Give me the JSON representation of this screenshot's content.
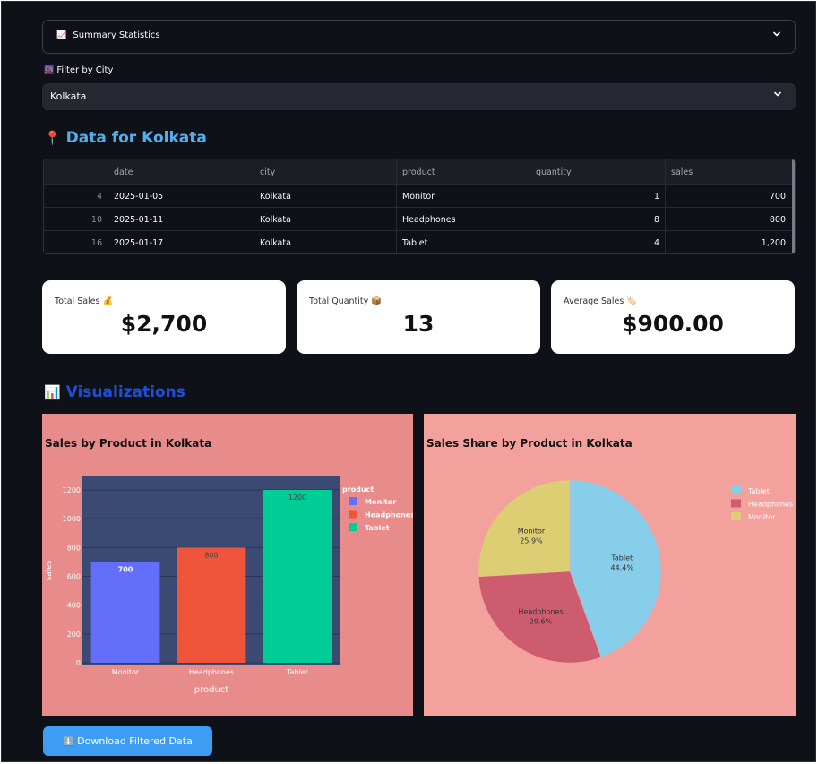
{
  "expander": {
    "icon": "📈",
    "label": "Summary Statistics"
  },
  "filter": {
    "icon": "🌆",
    "label": "Filter by City",
    "selected": "Kolkata"
  },
  "data_section": {
    "icon": "📍",
    "title": "Data for Kolkata"
  },
  "table": {
    "columns": [
      "",
      "date",
      "city",
      "product",
      "quantity",
      "sales"
    ],
    "rows": [
      [
        "4",
        "2025-01-05",
        "Kolkata",
        "Monitor",
        "1",
        "700"
      ],
      [
        "10",
        "2025-01-11",
        "Kolkata",
        "Headphones",
        "8",
        "800"
      ],
      [
        "16",
        "2025-01-17",
        "Kolkata",
        "Tablet",
        "4",
        "1,200"
      ]
    ]
  },
  "metrics": [
    {
      "label": "Total Sales 💰",
      "value": "$2,700"
    },
    {
      "label": "Total Quantity 📦",
      "value": "13"
    },
    {
      "label": "Average Sales 🏷️",
      "value": "$900.00"
    }
  ],
  "viz_section": {
    "icon": "📊",
    "title": "Visualizations"
  },
  "download_button": {
    "icon": "⬇️",
    "label": "Download Filtered Data"
  },
  "colors": {
    "accent_blue": "#4fb0ec",
    "monitor": "#636efa",
    "headphones": "#ef553b",
    "tablet": "#00cc96",
    "pie_tablet": "#87ceeb",
    "pie_headphones": "#cd5c6e",
    "pie_monitor": "#ddce74"
  },
  "chart_data": [
    {
      "type": "bar",
      "title": "Sales by Product in Kolkata",
      "categories": [
        "Monitor",
        "Headphones",
        "Tablet"
      ],
      "values": [
        700,
        800,
        1200
      ],
      "data_labels": [
        "700",
        "800",
        "1200"
      ],
      "xlabel": "product",
      "ylabel": "sales",
      "ylim": [
        0,
        1200
      ],
      "yticks": [
        "0",
        "200",
        "400",
        "600",
        "800",
        "1000",
        "1200"
      ],
      "legend_title": "product",
      "legend": [
        "Monitor",
        "Headphones",
        "Tablet"
      ],
      "legend_placement": "right",
      "grid": true
    },
    {
      "type": "pie",
      "title": "Sales Share by Product in Kolkata",
      "labels": [
        "Tablet",
        "Headphones",
        "Monitor"
      ],
      "values": [
        1200,
        800,
        700
      ],
      "slice_labels": [
        {
          "name": "Tablet",
          "pct": "44.4%"
        },
        {
          "name": "Headphones",
          "pct": "29.6%"
        },
        {
          "name": "Monitor",
          "pct": "25.9%"
        }
      ],
      "legend": [
        "Tablet",
        "Headphones",
        "Monitor"
      ],
      "legend_placement": "top-right"
    }
  ]
}
